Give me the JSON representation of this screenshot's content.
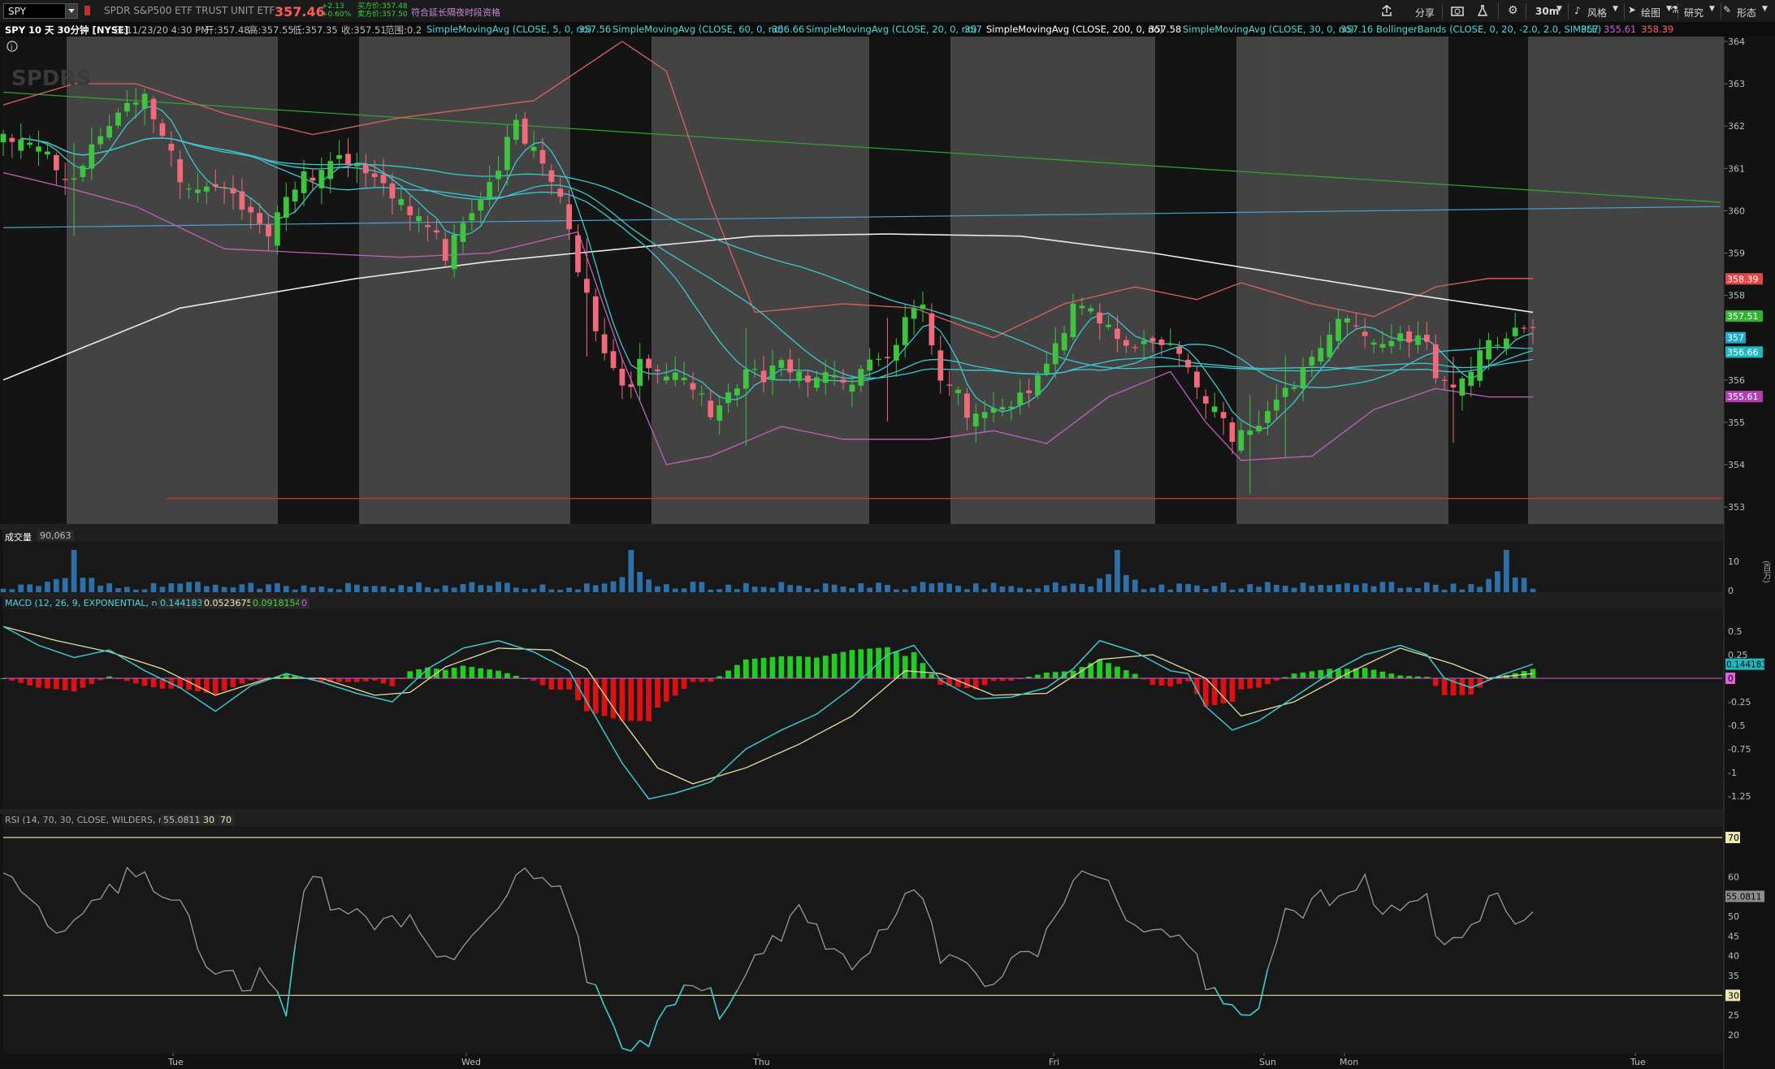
{
  "toolbar": {
    "symbol": "SPY",
    "description": "SPDR S&P500 ETF TRUST UNIT ETF",
    "last_price": "357.46",
    "change_abs": "+2.13",
    "change_pct": "+0.60%",
    "bid": "买方价:357.48",
    "ask": "卖方价:357.50",
    "ext_hours": "符合延长隔夜时段资格",
    "share_label": "分享",
    "timeframe_label": "30m",
    "style_label": "风格",
    "draw_label": "绘图",
    "study_label": "研究",
    "pattern_label": "形态"
  },
  "info": {
    "title": "SPY 10 天 30分钟 [NYSE]",
    "date": "日:11/23/20 4:30 PM",
    "open": "开:357.48",
    "high": "高:357.55",
    "low": "低:357.35",
    "close": "收:357.51",
    "range": "范围:0.2",
    "sma5": "SimpleMovingAvg (CLOSE, 5, 0, no)",
    "sma5_val": "357.56",
    "sma60": "SimpleMovingAvg (CLOSE, 60, 0, no)",
    "sma60_val": "356.66",
    "sma20": "SimpleMovingAvg (CLOSE, 20, 0, no)",
    "sma20_val": "357",
    "sma200": "SimpleMovingAvg (CLOSE, 200, 0, no)",
    "sma200_val": "357.58",
    "sma30": "SimpleMovingAvg (CLOSE, 30, 0, no)",
    "sma30_val": "357.16",
    "bb": "BollingerBands (CLOSE, 0, 20, -2.0, 2.0, SIMPLE)",
    "bb_mid": "357",
    "bb_low": "355.61",
    "bb_up": "358.39"
  },
  "volume_panel": {
    "title": "成交量",
    "value": "90,063",
    "unit": "(百万)"
  },
  "macd_panel": {
    "title": "MACD (12, 26, 9, EXPONENTIAL, no)",
    "value": "0.144183",
    "avg": "0.0523675",
    "diff": "0.0918154",
    "zero": "0"
  },
  "rsi_panel": {
    "title": "RSI (14, 70, 30, CLOSE, WILDERS, no)",
    "value": "55.0811",
    "ob": "30",
    "os": "70"
  },
  "colors": {
    "bg": "#121212",
    "band_dark": "#141414",
    "band_light": "#434343",
    "up": "#3ec43e",
    "down": "#f26a7a",
    "cyan": "#3bc8cf",
    "bb_upper": "#e06060",
    "bb_lower": "#c060c0",
    "sma200": "#e8e8e8",
    "trend_green": "#2ea82e",
    "trend_blue": "#4aa0d0",
    "support": "#c83030",
    "macd_up": "#22cc22",
    "macd_down": "#dd1111",
    "signal": "#e8dca0",
    "rsi": "#9a9a9a",
    "rsi_ob": "#e0dca0"
  },
  "chart_data": [
    {
      "type": "candlestick",
      "title": "SPY 10 天 30分钟 [NYSE]",
      "y_ticks": [
        "364",
        "363",
        "362",
        "361",
        "360",
        "359",
        "358",
        "357",
        "356",
        "355",
        "354",
        "353"
      ],
      "ylim": [
        353,
        364
      ],
      "x_labels": [
        "Tue",
        "Wed",
        "Thu",
        "Fri",
        "Sun",
        "Mon",
        "Tue"
      ],
      "price_labels": [
        {
          "text": "358.39",
          "color": "#e04848",
          "value": 358.39
        },
        {
          "text": "357.51",
          "color": "#32b432",
          "value": 357.51
        },
        {
          "text": "357",
          "color": "#21a8c8",
          "value": 357.0
        },
        {
          "text": "356.66",
          "color": "#1fb8bf",
          "value": 356.66
        },
        {
          "text": "355.61",
          "color": "#b040b0",
          "value": 355.61
        }
      ],
      "close_anchors": [
        [
          0,
          361.8
        ],
        [
          8,
          361.1
        ],
        [
          12,
          362.4
        ],
        [
          16,
          362.7
        ],
        [
          20,
          361.0
        ],
        [
          25,
          361.0
        ],
        [
          30,
          359.4
        ],
        [
          33,
          360.6
        ],
        [
          38,
          361.8
        ],
        [
          42,
          361.0
        ],
        [
          46,
          359.9
        ],
        [
          50,
          359.3
        ],
        [
          54,
          360.8
        ],
        [
          58,
          362.0
        ],
        [
          62,
          360.8
        ],
        [
          64,
          359.6
        ],
        [
          66,
          358.3
        ],
        [
          68,
          357.0
        ],
        [
          70,
          356.3
        ],
        [
          72,
          356.4
        ],
        [
          76,
          356.2
        ],
        [
          80,
          355.4
        ],
        [
          84,
          356.5
        ],
        [
          88,
          356.3
        ],
        [
          92,
          355.9
        ],
        [
          96,
          356.4
        ],
        [
          100,
          357.0
        ],
        [
          104,
          357.7
        ],
        [
          106,
          356.0
        ],
        [
          110,
          355.4
        ],
        [
          114,
          355.8
        ],
        [
          118,
          356.3
        ],
        [
          121,
          357.7
        ],
        [
          124,
          357.8
        ],
        [
          128,
          357.1
        ],
        [
          131,
          357.2
        ],
        [
          134,
          356.4
        ],
        [
          136,
          355.5
        ],
        [
          138,
          355.0
        ],
        [
          141,
          355.1
        ],
        [
          144,
          355.9
        ],
        [
          147,
          356.3
        ],
        [
          151,
          357.3
        ],
        [
          155,
          357.3
        ],
        [
          158,
          357.4
        ],
        [
          160,
          357.3
        ],
        [
          162,
          356.2
        ],
        [
          164,
          355.8
        ],
        [
          168,
          356.8
        ],
        [
          171,
          357.6
        ],
        [
          173,
          357.5
        ]
      ],
      "sma200_anchors": [
        [
          0,
          356.0
        ],
        [
          20,
          357.7
        ],
        [
          40,
          358.4
        ],
        [
          55,
          358.8
        ],
        [
          70,
          359.1
        ],
        [
          85,
          359.4
        ],
        [
          100,
          359.45
        ],
        [
          115,
          359.4
        ],
        [
          130,
          359.0
        ],
        [
          145,
          358.5
        ],
        [
          160,
          358.0
        ],
        [
          173,
          357.6
        ]
      ],
      "bb_upper_anchors": [
        [
          0,
          362.5
        ],
        [
          8,
          363.0
        ],
        [
          15,
          363.0
        ],
        [
          25,
          362.3
        ],
        [
          35,
          361.8
        ],
        [
          45,
          362.2
        ],
        [
          60,
          362.6
        ],
        [
          70,
          364.0
        ],
        [
          75,
          363.3
        ],
        [
          80,
          360.2
        ],
        [
          85,
          357.6
        ],
        [
          95,
          357.8
        ],
        [
          103,
          357.7
        ],
        [
          112,
          357.0
        ],
        [
          120,
          357.8
        ],
        [
          128,
          358.2
        ],
        [
          135,
          357.9
        ],
        [
          140,
          358.3
        ],
        [
          148,
          357.8
        ],
        [
          155,
          357.5
        ],
        [
          162,
          358.2
        ],
        [
          168,
          358.4
        ],
        [
          173,
          358.4
        ]
      ],
      "bb_lower_anchors": [
        [
          0,
          360.9
        ],
        [
          8,
          360.5
        ],
        [
          15,
          360.1
        ],
        [
          25,
          359.1
        ],
        [
          35,
          359.0
        ],
        [
          45,
          358.9
        ],
        [
          55,
          359.0
        ],
        [
          65,
          359.5
        ],
        [
          70,
          356.5
        ],
        [
          75,
          354.0
        ],
        [
          80,
          354.2
        ],
        [
          88,
          354.9
        ],
        [
          95,
          354.6
        ],
        [
          105,
          354.6
        ],
        [
          112,
          354.8
        ],
        [
          118,
          354.5
        ],
        [
          125,
          355.6
        ],
        [
          132,
          356.2
        ],
        [
          136,
          355.0
        ],
        [
          140,
          354.1
        ],
        [
          148,
          354.2
        ],
        [
          155,
          355.3
        ],
        [
          162,
          355.8
        ],
        [
          168,
          355.6
        ],
        [
          173,
          355.6
        ]
      ],
      "trend_green": [
        362.8,
        360.2
      ],
      "trend_blue": [
        359.6,
        360.1
      ],
      "support_value": 353.2
    },
    {
      "type": "bar",
      "title": "成交量",
      "y_ticks": [
        "10",
        "0"
      ],
      "spikes": [
        8,
        71,
        126,
        170
      ]
    },
    {
      "type": "bar",
      "title": "MACD (12, 26, 9, EXPONENTIAL, no)",
      "y_ticks": [
        "0.5",
        "0.25",
        "0",
        "-0.25",
        "-0.5",
        "-0.75",
        "-1",
        "-1.25"
      ],
      "ylim": [
        -1.35,
        0.72
      ],
      "macd_anchors": [
        [
          0,
          0.55
        ],
        [
          4,
          0.35
        ],
        [
          8,
          0.22
        ],
        [
          12,
          0.3
        ],
        [
          16,
          0.08
        ],
        [
          20,
          -0.1
        ],
        [
          24,
          -0.35
        ],
        [
          28,
          -0.08
        ],
        [
          32,
          0.05
        ],
        [
          36,
          -0.04
        ],
        [
          40,
          -0.16
        ],
        [
          44,
          -0.25
        ],
        [
          48,
          0.1
        ],
        [
          52,
          0.32
        ],
        [
          56,
          0.4
        ],
        [
          60,
          0.28
        ],
        [
          64,
          0.08
        ],
        [
          66,
          -0.25
        ],
        [
          70,
          -0.9
        ],
        [
          73,
          -1.28
        ],
        [
          76,
          -1.22
        ],
        [
          80,
          -1.1
        ],
        [
          84,
          -0.75
        ],
        [
          88,
          -0.55
        ],
        [
          92,
          -0.38
        ],
        [
          96,
          -0.1
        ],
        [
          100,
          0.25
        ],
        [
          103,
          0.35
        ],
        [
          106,
          -0.02
        ],
        [
          110,
          -0.22
        ],
        [
          114,
          -0.2
        ],
        [
          118,
          -0.1
        ],
        [
          121,
          0.1
        ],
        [
          124,
          0.4
        ],
        [
          128,
          0.28
        ],
        [
          132,
          0.08
        ],
        [
          134,
          0.05
        ],
        [
          136,
          -0.3
        ],
        [
          139,
          -0.55
        ],
        [
          142,
          -0.45
        ],
        [
          146,
          -0.2
        ],
        [
          150,
          0.05
        ],
        [
          154,
          0.25
        ],
        [
          158,
          0.35
        ],
        [
          161,
          0.25
        ],
        [
          163,
          0.0
        ],
        [
          166,
          -0.1
        ],
        [
          169,
          0.02
        ],
        [
          173,
          0.15
        ]
      ],
      "signal_anchors": [
        [
          0,
          0.55
        ],
        [
          6,
          0.4
        ],
        [
          12,
          0.28
        ],
        [
          18,
          0.1
        ],
        [
          24,
          -0.18
        ],
        [
          30,
          0.0
        ],
        [
          36,
          0.0
        ],
        [
          42,
          -0.18
        ],
        [
          46,
          -0.15
        ],
        [
          50,
          0.12
        ],
        [
          56,
          0.32
        ],
        [
          62,
          0.3
        ],
        [
          66,
          0.1
        ],
        [
          70,
          -0.45
        ],
        [
          74,
          -0.95
        ],
        [
          78,
          -1.12
        ],
        [
          84,
          -0.95
        ],
        [
          90,
          -0.7
        ],
        [
          96,
          -0.4
        ],
        [
          102,
          0.08
        ],
        [
          106,
          0.05
        ],
        [
          112,
          -0.18
        ],
        [
          118,
          -0.16
        ],
        [
          124,
          0.2
        ],
        [
          130,
          0.25
        ],
        [
          136,
          0.0
        ],
        [
          140,
          -0.4
        ],
        [
          146,
          -0.25
        ],
        [
          152,
          0.05
        ],
        [
          158,
          0.32
        ],
        [
          164,
          0.15
        ],
        [
          168,
          0.0
        ],
        [
          173,
          0.05
        ]
      ]
    },
    {
      "type": "line",
      "title": "RSI (14, 70, 30, CLOSE, WILDERS, no)",
      "y_ticks": [
        "70",
        "60",
        "55",
        "50",
        "45",
        "40",
        "35",
        "30",
        "25",
        "20"
      ],
      "ylim": [
        18,
        73
      ],
      "overbought": 70,
      "oversold": 30,
      "last": 55.0811,
      "rsi_anchors": [
        [
          0,
          59
        ],
        [
          3,
          55
        ],
        [
          6,
          46
        ],
        [
          10,
          58
        ],
        [
          12,
          64
        ],
        [
          16,
          60
        ],
        [
          20,
          52
        ],
        [
          24,
          40
        ],
        [
          28,
          38
        ],
        [
          32,
          27
        ],
        [
          34,
          58
        ],
        [
          38,
          58
        ],
        [
          42,
          54
        ],
        [
          46,
          48
        ],
        [
          50,
          40
        ],
        [
          54,
          52
        ],
        [
          58,
          64
        ],
        [
          62,
          60
        ],
        [
          64,
          52
        ],
        [
          66,
          40
        ],
        [
          70,
          22
        ],
        [
          74,
          24
        ],
        [
          78,
          34
        ],
        [
          82,
          30
        ],
        [
          86,
          48
        ],
        [
          90,
          52
        ],
        [
          94,
          40
        ],
        [
          98,
          45
        ],
        [
          102,
          62
        ],
        [
          104,
          56
        ],
        [
          106,
          40
        ],
        [
          110,
          36
        ],
        [
          114,
          44
        ],
        [
          118,
          46
        ],
        [
          122,
          62
        ],
        [
          126,
          58
        ],
        [
          130,
          52
        ],
        [
          134,
          44
        ],
        [
          136,
          32
        ],
        [
          138,
          28
        ],
        [
          142,
          32
        ],
        [
          145,
          56
        ],
        [
          150,
          55
        ],
        [
          154,
          60
        ],
        [
          158,
          56
        ],
        [
          161,
          60
        ],
        [
          163,
          45
        ],
        [
          166,
          48
        ],
        [
          169,
          55
        ],
        [
          173,
          55
        ]
      ]
    }
  ]
}
